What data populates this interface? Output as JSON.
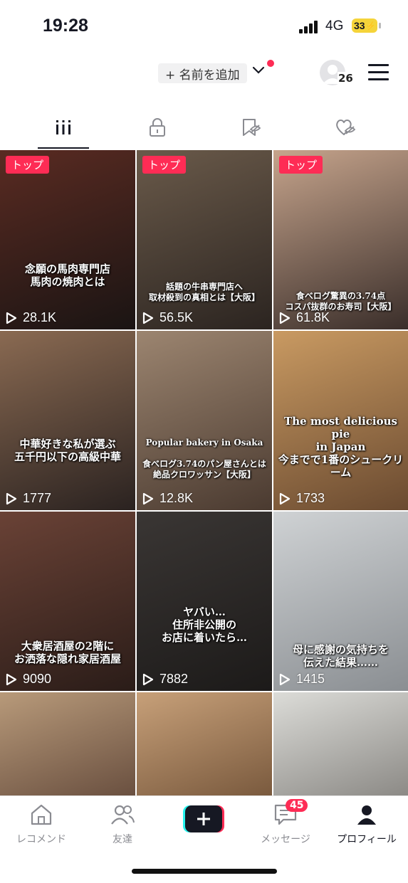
{
  "status_bar": {
    "time": "19:28",
    "network": "4G",
    "battery": "33"
  },
  "header": {
    "add_name": "+ 名前を追加",
    "avatar_count": "26"
  },
  "tabs": [
    {
      "name": "videos",
      "icon": "grid-icon"
    },
    {
      "name": "private",
      "icon": "lock-icon"
    },
    {
      "name": "saved",
      "icon": "bookmark-icon"
    },
    {
      "name": "liked",
      "icon": "heart-icon"
    }
  ],
  "videos": [
    {
      "badge": "トップ",
      "caption": "念願の馬肉専門店\n馬肉の焼肉とは",
      "views": "28.1K",
      "colors": [
        "#5a2b22",
        "#1a1413"
      ]
    },
    {
      "badge": "トップ",
      "caption": "話題の牛串専門店へ\n取材殺到の真相とは【大阪】",
      "views": "56.5K",
      "colors": [
        "#6a5a4a",
        "#2b2420"
      ]
    },
    {
      "badge": "トップ",
      "caption": "食べログ驚異の3.74点\nコスパ抜群のお寿司【大阪】",
      "views": "61.8K",
      "colors": [
        "#c6a48c",
        "#3a2e2a"
      ]
    },
    {
      "badge": "",
      "caption": "中華好きな私が選ぶ\n五千円以下の高級中華",
      "views": "1777",
      "colors": [
        "#8a6a52",
        "#2a2220"
      ]
    },
    {
      "badge": "",
      "caption": "Popular bakery in Osaka\n\n食べログ3.74のパン屋さんとは\n絶品クロワッサン【大阪】",
      "views": "12.8K",
      "colors": [
        "#9c8570",
        "#4a3a30"
      ]
    },
    {
      "badge": "",
      "caption": "The most delicious pie\nin Japan\n今までで1番のシュークリーム",
      "views": "1733",
      "colors": [
        "#c99a62",
        "#6a4a30"
      ]
    },
    {
      "badge": "",
      "caption": "大衆居酒屋の2階に\nお洒落な隠れ家居酒屋",
      "views": "9090",
      "colors": [
        "#6a4236",
        "#2a1c18"
      ]
    },
    {
      "badge": "",
      "caption": "ヤバい…\n住所非公開の\nお店に着いたら…",
      "views": "7882",
      "colors": [
        "#3a3634",
        "#1c1a19"
      ]
    },
    {
      "badge": "",
      "caption": "母に感謝の気持ちを\n伝えた結果……",
      "views": "1415",
      "colors": [
        "#cfd2d4",
        "#8a8e92"
      ]
    },
    {
      "badge": "",
      "caption": "",
      "views": "",
      "colors": [
        "#b89a7a",
        "#6a5040"
      ]
    },
    {
      "badge": "",
      "caption": "",
      "views": "",
      "colors": [
        "#c7a079",
        "#7a5a3e"
      ]
    },
    {
      "badge": "",
      "caption": "",
      "views": "",
      "colors": [
        "#dcdcd8",
        "#8c8a86"
      ]
    }
  ],
  "bottom_nav": [
    {
      "label": "レコメンド",
      "icon": "home-icon"
    },
    {
      "label": "友達",
      "icon": "friends-icon"
    },
    {
      "label": "",
      "icon": "create-icon"
    },
    {
      "label": "メッセージ",
      "icon": "inbox-icon",
      "badge": "45"
    },
    {
      "label": "プロフィール",
      "icon": "profile-icon",
      "active": true
    }
  ],
  "colors": {
    "accent": "#fe2c55",
    "cyan": "#25f4ee",
    "text": "#161823",
    "muted": "#8a8b91"
  }
}
